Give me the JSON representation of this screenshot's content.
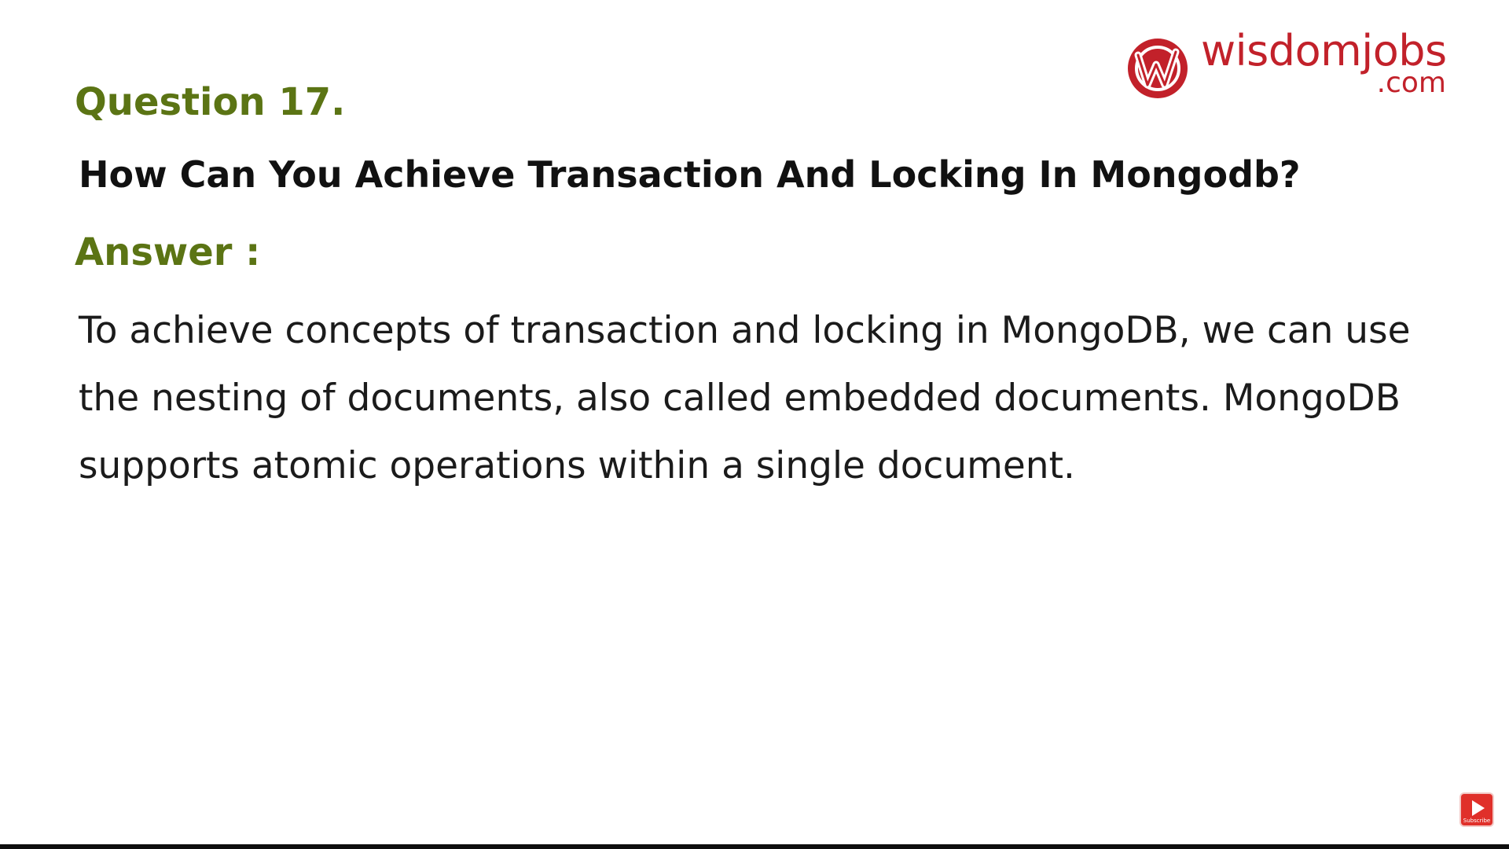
{
  "logo": {
    "brand_name": "wisdomjobs",
    "brand_tld": ".com",
    "mark_icon": "wisdomjobs-w-logo-icon",
    "brand_color": "#c2212a"
  },
  "question": {
    "label": "Question 17.",
    "title": "How Can You Achieve Transaction And Locking In Mongodb?",
    "label_color": "#5b7414"
  },
  "answer": {
    "label": "Answer :",
    "text": "To achieve concepts of transaction and locking in MongoDB, we can use the nesting of documents, also called embedded documents. MongoDB supports atomic operations within a single document."
  },
  "subscribe": {
    "icon": "subscribe-play-icon",
    "label": "Subscribe",
    "color": "#e0302a"
  }
}
